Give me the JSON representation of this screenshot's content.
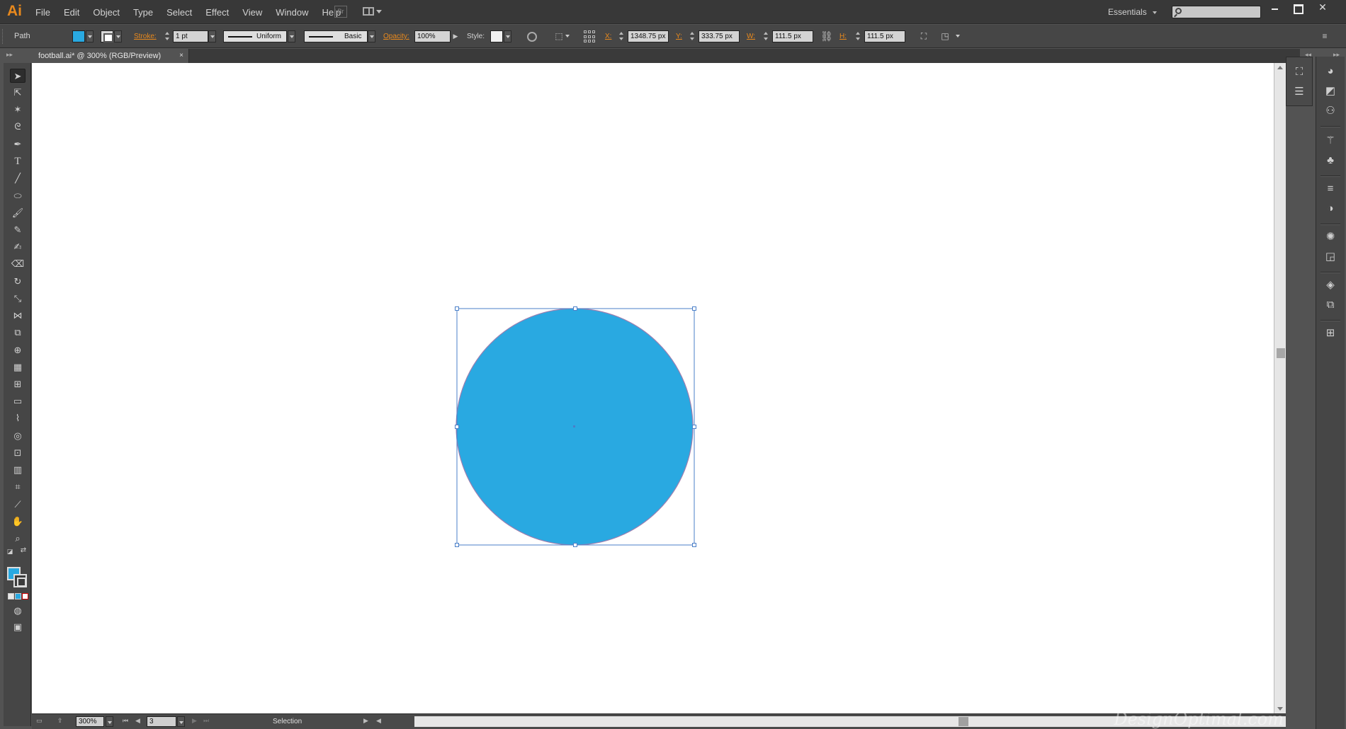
{
  "app": {
    "logo": "Ai"
  },
  "menu": [
    "File",
    "Edit",
    "Object",
    "Type",
    "Select",
    "Effect",
    "View",
    "Window",
    "Help"
  ],
  "bridge_label": "Br",
  "workspace": {
    "label": "Essentials"
  },
  "window_controls": {
    "close": "✕"
  },
  "control_bar": {
    "object_type": "Path",
    "fill_color": "#29a9e1",
    "stroke_label": "Stroke:",
    "stroke_weight": "1 pt",
    "profile": "Uniform",
    "brush": "Basic",
    "opacity_label": "Opacity:",
    "opacity": "100%",
    "style_label": "Style:",
    "x_label": "X:",
    "x": "1348.75 px",
    "y_label": "Y:",
    "y": "333.75 px",
    "w_label": "W:",
    "w": "111.5 px",
    "h_label": "H:",
    "h": "111.5 px"
  },
  "document_tab": {
    "title": "football.ai* @ 300% (RGB/Preview)",
    "close": "×"
  },
  "artwork": {
    "shape": "circle",
    "fill": "#29a9e1",
    "stroke": "#9a7fb1"
  },
  "status_bar": {
    "zoom": "300%",
    "artboard": "3",
    "tool": "Selection"
  },
  "watermark": "DesignOptimal.com"
}
